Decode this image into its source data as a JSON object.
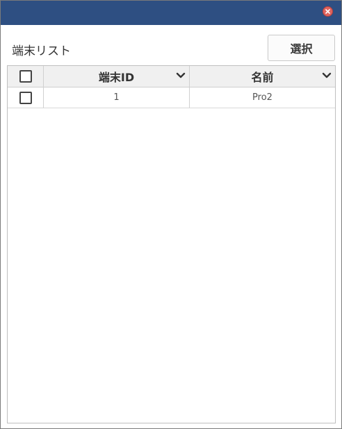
{
  "dialog": {
    "list_title": "端末リスト",
    "select_label": "選択",
    "close_icon": "close-icon"
  },
  "table": {
    "columns": [
      {
        "label": "端末ID",
        "sort_icon": "chevron-down-icon"
      },
      {
        "label": "名前",
        "sort_icon": "chevron-down-icon"
      }
    ],
    "rows": [
      {
        "id": "1",
        "name": "Pro2",
        "checked": false
      }
    ]
  },
  "colors": {
    "titlebar": "#2e4f82",
    "close": "#e0645e",
    "header_bg": "#f0f0f0"
  }
}
